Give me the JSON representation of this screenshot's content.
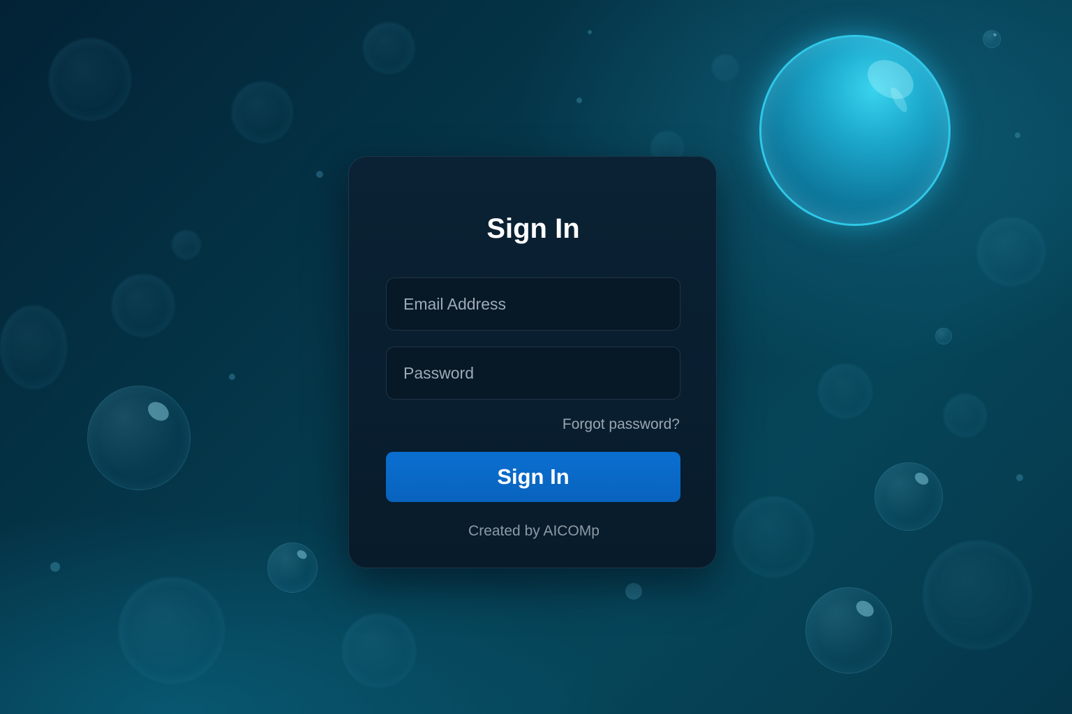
{
  "login": {
    "title": "Sign In",
    "email_placeholder": "Email Address",
    "password_placeholder": "Password",
    "forgot_password": "Forgot password?",
    "submit_label": "Sign In",
    "credit": "Created by AICOMp"
  },
  "colors": {
    "background": "#053a4d",
    "card": "#081b2b",
    "button": "#0a6fd0",
    "orb": "#1ca8cc"
  },
  "background_icons": [
    "bubble",
    "glowing-orb"
  ]
}
